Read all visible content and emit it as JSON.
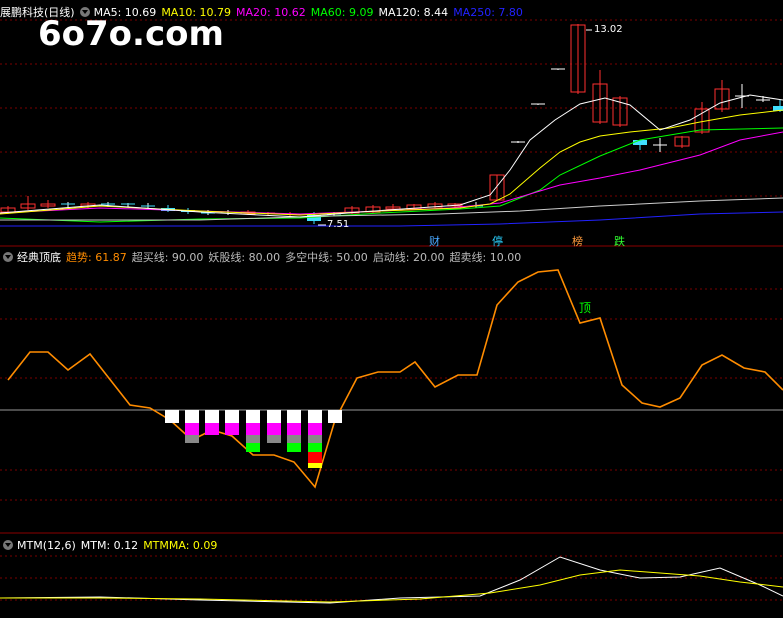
{
  "watermark": "6o7o.com",
  "main_panel": {
    "stock_title": "展鹏科技(日线)",
    "ma": [
      {
        "label": "MA5: 10.69",
        "color": "#ffffff"
      },
      {
        "label": "MA10: 10.79",
        "color": "#ffff00"
      },
      {
        "label": "MA20: 10.62",
        "color": "#ff00ff"
      },
      {
        "label": "MA60: 9.09",
        "color": "#00ff00"
      },
      {
        "label": "MA120: 8.44",
        "color": "#ffffff"
      },
      {
        "label": "MA250: 7.80",
        "color": "#2222ff"
      }
    ],
    "high_label": "13.02",
    "low_label": "7.51",
    "tags": [
      {
        "text": "财",
        "color": "#4aa8ff"
      },
      {
        "text": "停",
        "color": "#2ad0ff"
      },
      {
        "text": "榜",
        "color": "#ff9a3c"
      },
      {
        "text": "跌",
        "color": "#30ff30"
      }
    ]
  },
  "indicator_panel": {
    "title": "经典顶底",
    "items": [
      {
        "label": "趋势: 61.87",
        "color": "#ff8c00"
      },
      {
        "label": "超买线: 90.00",
        "color": "#bbbbbb"
      },
      {
        "label": "妖股线: 80.00",
        "color": "#bbbbbb"
      },
      {
        "label": "多空中线: 50.00",
        "color": "#bbbbbb"
      },
      {
        "label": "启动线: 20.00",
        "color": "#bbbbbb"
      },
      {
        "label": "超卖线: 10.00",
        "color": "#bbbbbb"
      }
    ],
    "top_marker": "顶"
  },
  "mtm_panel": {
    "title": "MTM(12,6)",
    "items": [
      {
        "label": "MTM: 0.12",
        "color": "#ffffff"
      },
      {
        "label": "MTMMA: 0.09",
        "color": "#ffff00"
      }
    ]
  },
  "colors": {
    "background": "#000000",
    "grid": "#8b0000",
    "up_candle": "#ff3030",
    "down_candle": "#40e0ff",
    "trend": "#ff8c00"
  }
}
